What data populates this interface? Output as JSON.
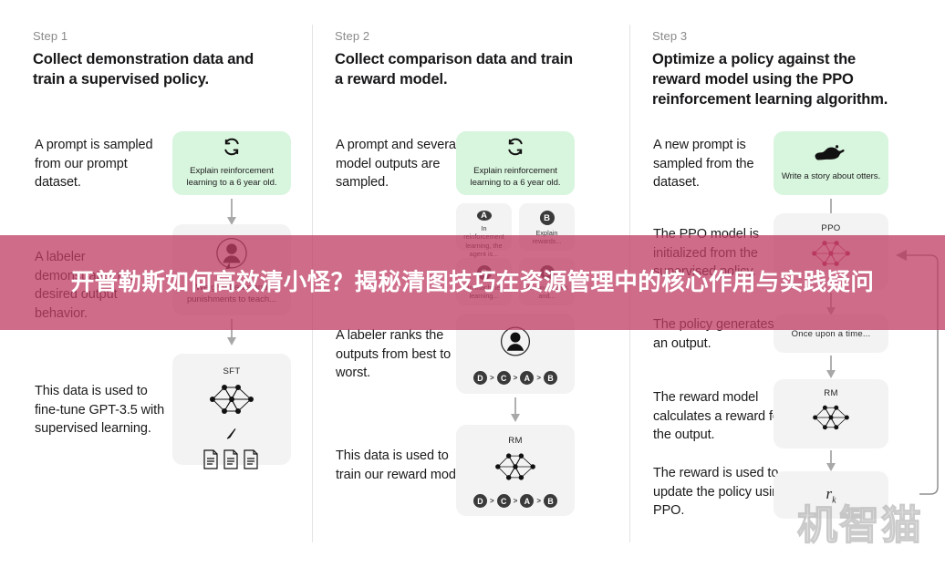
{
  "overlay": {
    "banner_text": "开普勒斯如何高效清小怪？揭秘清图技巧在资源管理中的核心作用与实践疑问",
    "banner_color": "#be3e64",
    "text_color": "#ffffff"
  },
  "watermark": {
    "text": "机智猫"
  },
  "colors": {
    "prompt_green": "#d8f5de",
    "card_gray": "#f3f3f3",
    "divider": "#e3e3e3",
    "step_label": "#8a8a8a",
    "ppo_network": "#c0395f"
  },
  "columns": [
    {
      "step_label": "Step 1",
      "step_title": "Collect demonstration data and train a supervised policy.",
      "notes": [
        "A prompt is sampled from our prompt dataset.",
        "A labeler demonstrates the desired output behavior.",
        "This data is used to fine-tune GPT-3.5 with supervised learning."
      ],
      "cards": [
        {
          "name": "prompt-card",
          "icon": "refresh-icon",
          "text": "Explain reinforcement learning to a 6 year old."
        },
        {
          "name": "labeler-card",
          "icon": "labeler-person-icon",
          "text": "We give treats and punishments to teach..."
        },
        {
          "name": "sft-card",
          "label": "SFT",
          "icon": "neural-network-icon"
        }
      ]
    },
    {
      "step_label": "Step 2",
      "step_title": "Collect comparison data and train a reward model.",
      "notes": [
        "A prompt and several model outputs are sampled.",
        "A labeler ranks the outputs from best to worst.",
        "This data is used to train our reward model."
      ],
      "cards": [
        {
          "name": "prompt-card",
          "icon": "refresh-icon",
          "text": "Explain reinforcement learning to a 6 year old."
        },
        {
          "name": "output-option-a",
          "badge": "A",
          "text": "In reinforcement learning, the agent is..."
        },
        {
          "name": "output-option-b",
          "badge": "B",
          "text": "Explain rewards..."
        },
        {
          "name": "output-option-c",
          "badge": "C",
          "text": "In machine learning..."
        },
        {
          "name": "output-option-d",
          "badge": "D",
          "text": "We give treats and..."
        },
        {
          "name": "ranking-card",
          "icon": "labeler-person-icon",
          "ranking": [
            "D",
            "C",
            "A",
            "B"
          ]
        },
        {
          "name": "rm-card",
          "label": "RM",
          "icon": "neural-network-icon",
          "ranking": [
            "D",
            "C",
            "A",
            "B"
          ]
        }
      ]
    },
    {
      "step_label": "Step 3",
      "step_title": "Optimize a policy against the reward model using the PPO reinforcement learning algorithm.",
      "notes": [
        "A new prompt is sampled from the dataset.",
        "The PPO model is initialized from the supervised policy.",
        "The policy generates an output.",
        "The reward model calculates a reward for the output.",
        "The reward is used to update the policy using PPO."
      ],
      "cards": [
        {
          "name": "prompt-card",
          "icon": "otter-icon",
          "text": "Write a story about otters."
        },
        {
          "name": "ppo-card",
          "label": "PPO",
          "icon": "neural-network-icon"
        },
        {
          "name": "output-card",
          "text": "Once upon a time..."
        },
        {
          "name": "rm-card",
          "label": "RM",
          "icon": "neural-network-icon"
        },
        {
          "name": "reward-card",
          "text": "r",
          "subscript": "k"
        }
      ]
    }
  ]
}
